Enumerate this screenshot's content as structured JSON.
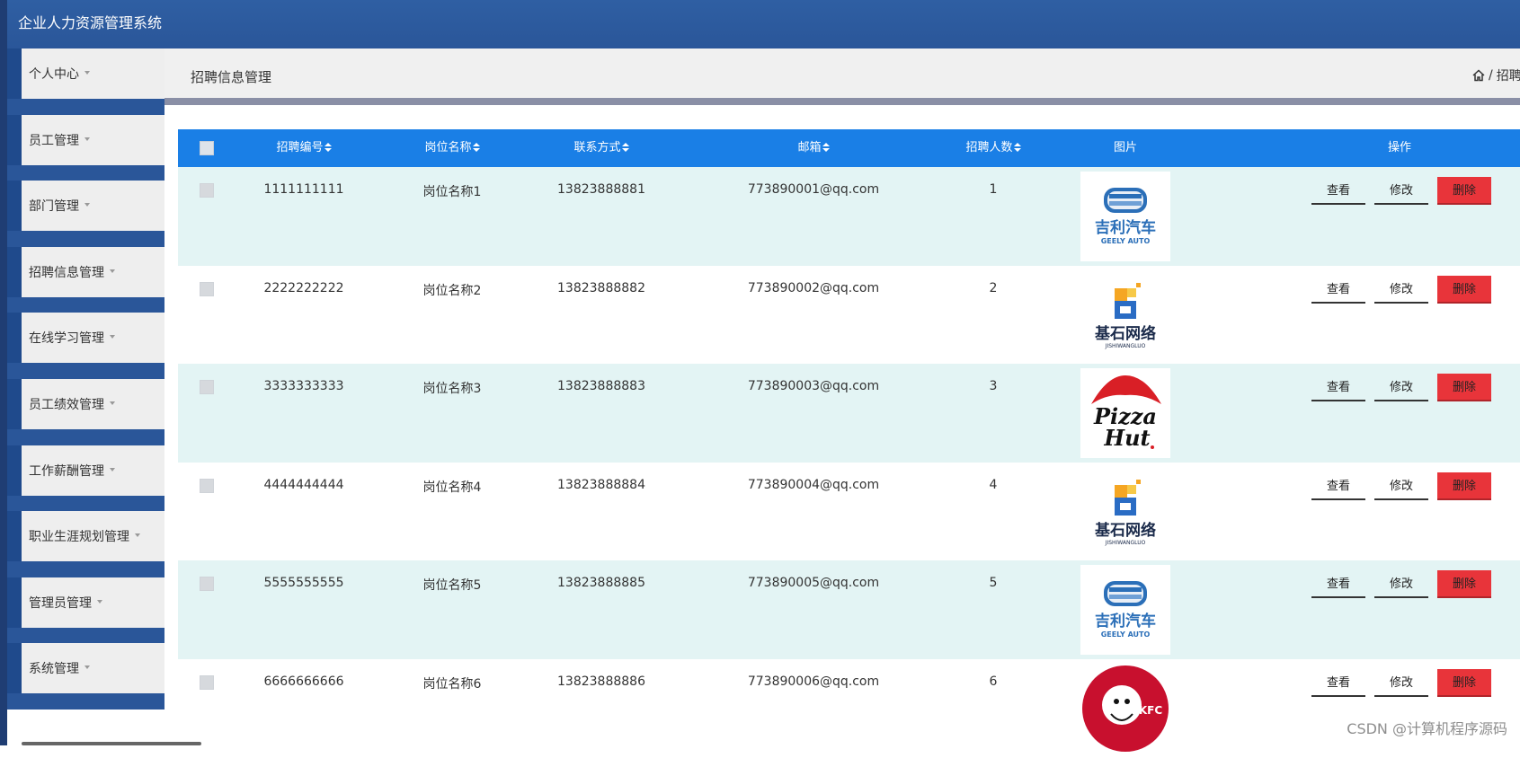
{
  "app": {
    "title": "企业人力资源管理系统"
  },
  "sidebar": {
    "items": [
      {
        "label": "个人中心"
      },
      {
        "label": "员工管理"
      },
      {
        "label": "部门管理"
      },
      {
        "label": "招聘信息管理"
      },
      {
        "label": "在线学习管理"
      },
      {
        "label": "员工绩效管理"
      },
      {
        "label": "工作薪酬管理"
      },
      {
        "label": "职业生涯规划管理"
      },
      {
        "label": "管理员管理"
      },
      {
        "label": "系统管理"
      }
    ]
  },
  "header": {
    "page_title": "招聘信息管理",
    "breadcrumb_sep": "/",
    "breadcrumb_current": "招聘"
  },
  "table": {
    "columns": [
      "招聘编号",
      "岗位名称",
      "联系方式",
      "邮箱",
      "招聘人数",
      "图片",
      "操作"
    ],
    "rows": [
      {
        "id": "1111111111",
        "position": "岗位名称1",
        "phone": "13823888881",
        "email": "773890001@qq.com",
        "count": "1",
        "image": "geely-auto-logo"
      },
      {
        "id": "2222222222",
        "position": "岗位名称2",
        "phone": "13823888882",
        "email": "773890002@qq.com",
        "count": "2",
        "image": "jishi-wangluo-logo"
      },
      {
        "id": "3333333333",
        "position": "岗位名称3",
        "phone": "13823888883",
        "email": "773890003@qq.com",
        "count": "3",
        "image": "pizza-hut-logo"
      },
      {
        "id": "4444444444",
        "position": "岗位名称4",
        "phone": "13823888884",
        "email": "773890004@qq.com",
        "count": "4",
        "image": "jishi-wangluo-logo"
      },
      {
        "id": "5555555555",
        "position": "岗位名称5",
        "phone": "13823888885",
        "email": "773890005@qq.com",
        "count": "5",
        "image": "geely-auto-logo"
      },
      {
        "id": "6666666666",
        "position": "岗位名称6",
        "phone": "13823888886",
        "email": "773890006@qq.com",
        "count": "6",
        "image": "kfc-logo"
      }
    ],
    "actions": {
      "view": "查看",
      "edit": "修改",
      "delete": "删除"
    }
  },
  "logos": {
    "geely": {
      "cn": "吉利汽车",
      "en": "GEELY AUTO"
    },
    "jishi": {
      "cn": "基石网络",
      "en": "JISHIWANGLUO"
    },
    "pizza": {
      "line1": "Pizza",
      "line2": "Hut"
    },
    "kfc": {
      "text": "KFC"
    }
  },
  "watermark": "CSDN @计算机程序源码",
  "colors": {
    "topbar": "#2a5699",
    "table_header": "#1a7fe6",
    "row_alt": "#e3f4f4",
    "delete": "#e8343a"
  }
}
